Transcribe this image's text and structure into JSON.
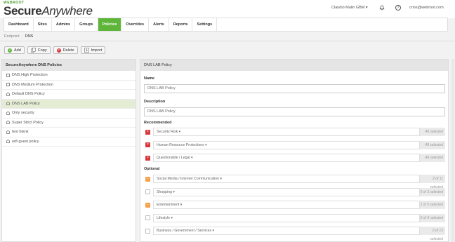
{
  "brand": {
    "top": "WEBROOT",
    "name_bold": "Secure",
    "name_italic": "Anywhere"
  },
  "user": {
    "name": "Claudio Malin GBM ▾",
    "email": "crios@webroot.com"
  },
  "nav": [
    "Dashboard",
    "Sites",
    "Admins",
    "Groups",
    "Policies",
    "Overrides",
    "Alerts",
    "Reports",
    "Settings"
  ],
  "nav_active": 4,
  "subtabs": [
    "Endpoint",
    "DNS"
  ],
  "toolbar": {
    "add": "Add",
    "copy": "Copy",
    "delete": "Delete",
    "import": "Import"
  },
  "left": {
    "header": "SecureAnywhere DNS Policies",
    "policies": [
      "DNS High Protection",
      "DNS Medium Protection",
      "Default DNS Policy",
      "DNS LAB Policy",
      "Only security",
      "Super Strict Policy",
      "test blank",
      "wifi guest policy"
    ],
    "selected": 3
  },
  "right": {
    "header": "DNS LAB Policy",
    "name_label": "Name",
    "name_value": "DNS LAB Policy",
    "desc_label": "Description",
    "desc_value": "DNS LAB Policy",
    "recommended_label": "Recommended",
    "optional_label": "Optional",
    "recommended": [
      {
        "name": "Security Risk ▾",
        "status": "All selected"
      },
      {
        "name": "Human Resource Protections ▾",
        "status": "All selected"
      },
      {
        "name": "Questionable / Legal ▾",
        "status": "All selected"
      }
    ],
    "optional": [
      {
        "name": "Social Media / Internet Communication ▾",
        "status": "2 of 11 selected"
      },
      {
        "name": "Shopping ▾",
        "status": "0 of 3 selected"
      },
      {
        "name": "Entertainment ▾",
        "status": "1 of 5 selected"
      },
      {
        "name": "Lifestyle ▾",
        "status": "0 of 9 selected"
      },
      {
        "name": "Business / Government / Services ▾",
        "status": "0 of 13 selected"
      }
    ]
  },
  "colors": {
    "accent": "#5fb53a",
    "red": "#d9363a",
    "orange": "#f5a04a",
    "selected_row": "#e4ecd4"
  }
}
